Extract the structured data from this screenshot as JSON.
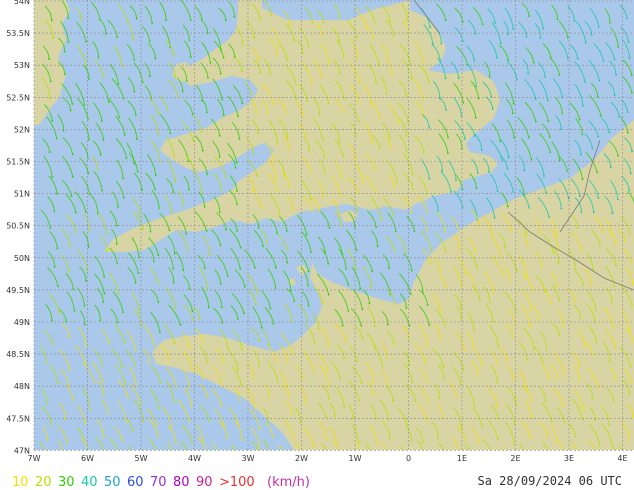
{
  "map": {
    "latitude_labels": [
      "54N",
      "53.5N",
      "53N",
      "52.5N",
      "52N",
      "51.5N",
      "51N",
      "50.5N",
      "50N",
      "49.5N",
      "49N",
      "48.5N",
      "48N",
      "47.5N",
      "47N"
    ],
    "longitude_labels": [
      "7W",
      "6W",
      "5W",
      "4W",
      "3W",
      "2W",
      "1W",
      "0",
      "1E",
      "2E",
      "3E",
      "4E"
    ],
    "colors": {
      "sea": "#a9c8ea",
      "land": "#d8d4a4",
      "grid": "#8a8a8a",
      "border": "#7a7a7a"
    }
  },
  "legend": {
    "items": [
      {
        "label": "10",
        "color": "#f2e000"
      },
      {
        "label": "20",
        "color": "#b6e000"
      },
      {
        "label": "30",
        "color": "#2fd000"
      },
      {
        "label": "40",
        "color": "#19c8a8"
      },
      {
        "label": "50",
        "color": "#1e9ee0"
      },
      {
        "label": "60",
        "color": "#2c4de0"
      },
      {
        "label": "70",
        "color": "#9b2ad8"
      },
      {
        "label": "80",
        "color": "#b000c0"
      },
      {
        "label": "90",
        "color": "#d0208a"
      },
      {
        "label": ">100",
        "color": "#e83030"
      }
    ],
    "unit": "(km/h)",
    "unit_color": "#c030b0"
  },
  "timestamp": "Sa 28/09/2024 06 UTC"
}
